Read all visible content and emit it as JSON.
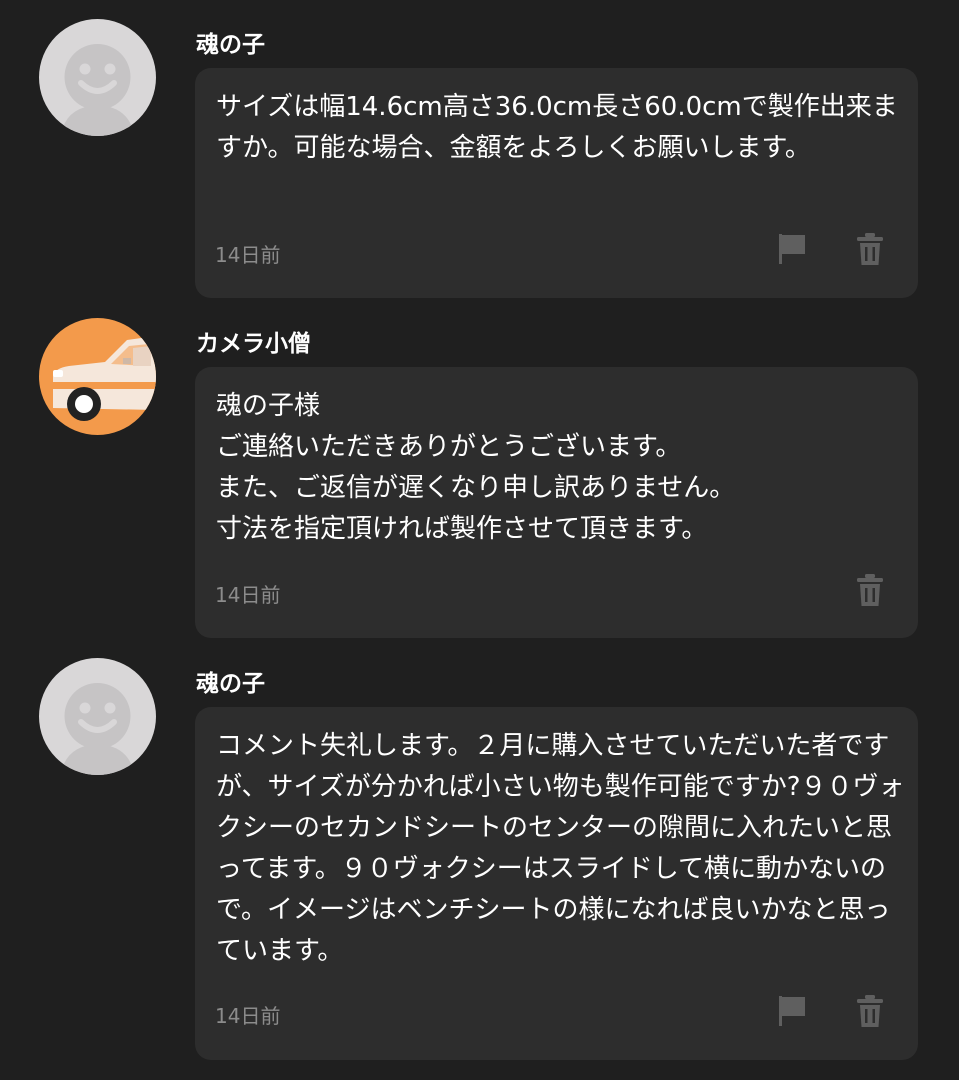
{
  "comments": [
    {
      "username": "魂の子",
      "avatar": "default-face-avatar",
      "text": "サイズは幅14.6cm高さ36.0cm長さ60.0cmで製作出来ますか。可能な場合、金額をよろしくお願いします。",
      "time": "14日前",
      "actions": [
        "flag-icon",
        "trash-icon"
      ]
    },
    {
      "username": "カメラ小僧",
      "avatar": "car-avatar",
      "text": "魂の子様\nご連絡いただきありがとうございます。\nまた、ご返信が遅くなり申し訳ありません。\n寸法を指定頂ければ製作させて頂きます。",
      "time": "14日前",
      "actions": [
        "trash-icon"
      ]
    },
    {
      "username": "魂の子",
      "avatar": "default-face-avatar",
      "text": "コメント失礼します。２月に購入させていただいた者ですが、サイズが分かれば小さい物も製作可能ですか?９０ヴォクシーのセカンドシートのセンターの隙間に入れたいと思ってます。９０ヴォクシーはスライドして横に動かないので。イメージはベンチシートの様になれば良いかなと思っています。",
      "time": "14日前",
      "actions": [
        "flag-icon",
        "trash-icon"
      ]
    }
  ],
  "colors": {
    "background": "#1f1f1f",
    "bubble": "#2d2d2d",
    "text": "#ffffff",
    "muted": "#8c8c8c",
    "icon": "#5f5f5f",
    "avatar_orange": "#f39a4b",
    "avatar_gray": "#d9d7d8"
  }
}
